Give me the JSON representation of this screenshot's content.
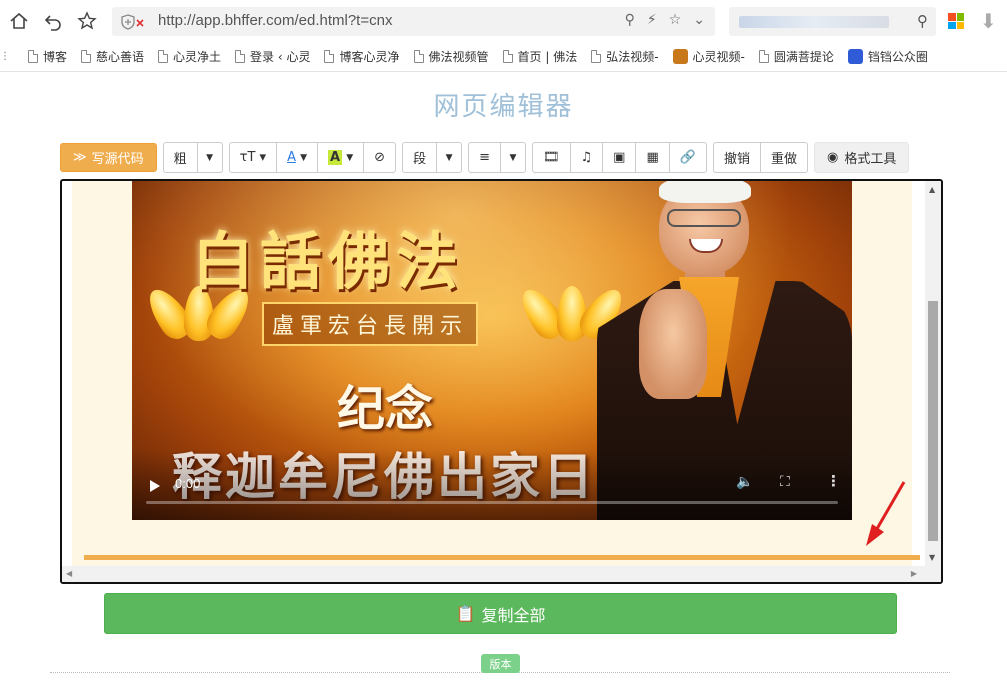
{
  "browser": {
    "url": "http://app.bhffer.com/ed.html?t=cnx",
    "bookmarks": [
      {
        "label": "博客",
        "fav": "doc"
      },
      {
        "label": "慈心善语",
        "fav": "doc"
      },
      {
        "label": "心灵净土",
        "fav": "doc"
      },
      {
        "label": "登录 ‹ 心灵",
        "fav": "doc"
      },
      {
        "label": "博客心灵净",
        "fav": "doc"
      },
      {
        "label": "佛法视频管",
        "fav": "doc"
      },
      {
        "label": "首页 | 佛法",
        "fav": "doc"
      },
      {
        "label": "弘法视频-",
        "fav": "doc"
      },
      {
        "label": "心灵视频-",
        "fav": "color",
        "color": "#c8781a"
      },
      {
        "label": "圆满菩提论",
        "fav": "doc"
      },
      {
        "label": "铛铛公众圈",
        "fav": "color",
        "color": "#2f5bd6"
      }
    ]
  },
  "page": {
    "title": "网页编辑器"
  },
  "toolbar": {
    "source_code": "写源代码",
    "bold": "粗",
    "paragraph": "段",
    "undo": "撤销",
    "redo": "重做",
    "format_tools": "格式工具"
  },
  "video": {
    "title_text": "白話佛法",
    "subtitle_text": "盧軍宏台長開示",
    "line1": "纪念",
    "line2": "释迦牟尼佛出家日",
    "time": "0:00",
    "progress": 0
  },
  "actions": {
    "copy_all": "复制全部",
    "version": "版本"
  },
  "colors": {
    "source_btn": "#f0ad4e",
    "copy_btn": "#5cb85c",
    "title": "#9fc0d8",
    "accent_line": "#f0ad4e",
    "arrow": "#e02020"
  }
}
